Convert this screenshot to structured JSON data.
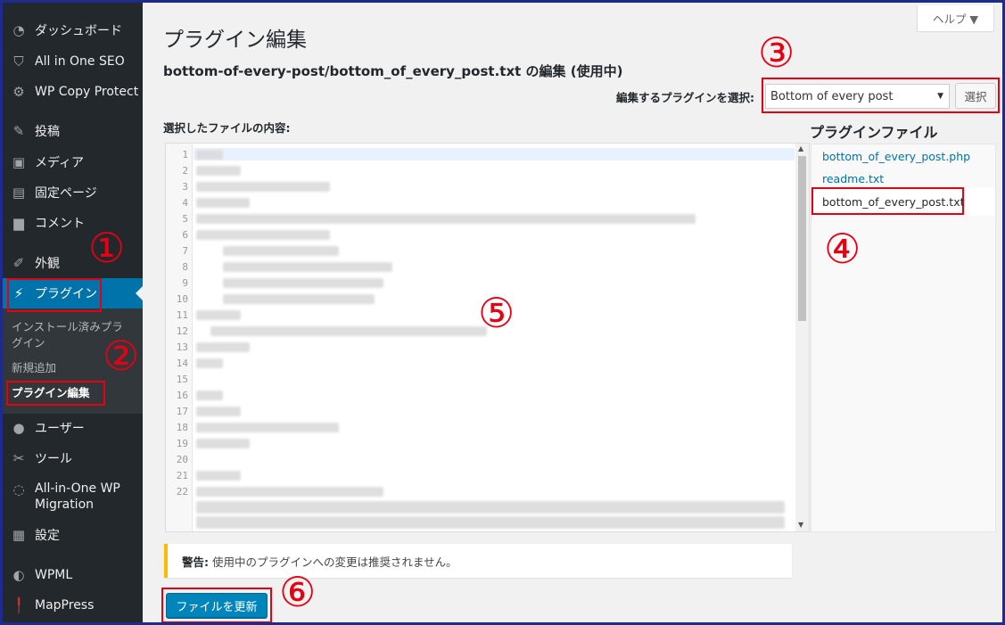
{
  "sidebar": {
    "items": [
      {
        "label": "ダッシュボード",
        "icon": "dashboard-icon"
      },
      {
        "label": "All in One SEO",
        "icon": "shield-icon"
      },
      {
        "label": "WP Copy Protect",
        "icon": "gear-icon"
      },
      {
        "label": "投稿",
        "icon": "pin-icon"
      },
      {
        "label": "メディア",
        "icon": "media-icon"
      },
      {
        "label": "固定ページ",
        "icon": "page-icon"
      },
      {
        "label": "コメント",
        "icon": "comment-icon"
      },
      {
        "label": "外観",
        "icon": "brush-icon"
      },
      {
        "label": "プラグイン",
        "icon": "plugin-icon"
      },
      {
        "label": "ユーザー",
        "icon": "user-icon"
      },
      {
        "label": "ツール",
        "icon": "wrench-icon"
      },
      {
        "label": "All-in-One WP",
        "label2": "Migration",
        "icon": "migration-icon"
      },
      {
        "label": "設定",
        "icon": "settings-icon"
      },
      {
        "label": "WPML",
        "icon": "wpml-icon"
      },
      {
        "label": "MapPress",
        "icon": "map-pin-icon"
      }
    ],
    "submenu": {
      "installed_line1": "インストール済みプラ",
      "installed_line2": "グイン",
      "add_new": "新規追加",
      "editor": "プラグイン編集"
    }
  },
  "annotations": [
    "①",
    "②",
    "③",
    "④",
    "⑤",
    "⑥"
  ],
  "help_tab": "ヘルプ ▼",
  "page_title": "プラグイン編集",
  "file_heading": "bottom-of-every-post/bottom_of_every_post.txt の編集 (使用中)",
  "plugin_select": {
    "label": "編集するプラグインを選択:",
    "value": "Bottom of every post",
    "button": "選択"
  },
  "content_label": "選択したファイルの内容:",
  "plugin_files": {
    "title": "プラグインファイル",
    "files": [
      "bottom_of_every_post.php",
      "readme.txt",
      "bottom_of_every_post.txt"
    ]
  },
  "editor": {
    "line_numbers": [
      "1",
      "2",
      "3",
      "4",
      "5",
      "6",
      "7",
      "8",
      "9",
      "10",
      "11",
      "12",
      "13",
      "14",
      "15",
      "16",
      "17",
      "18",
      "19",
      "20",
      "21",
      "22"
    ]
  },
  "notice": {
    "strong": "警告:",
    "text": "使用中のプラグインへの変更は推奨されません。"
  },
  "update_button": "ファイルを更新",
  "colors": {
    "sidebar_bg": "#23282d",
    "active_blue": "#0073aa",
    "annotation_red": "#e60012",
    "primary_button": "#0085ba",
    "notice_warning": "#ffb900"
  }
}
